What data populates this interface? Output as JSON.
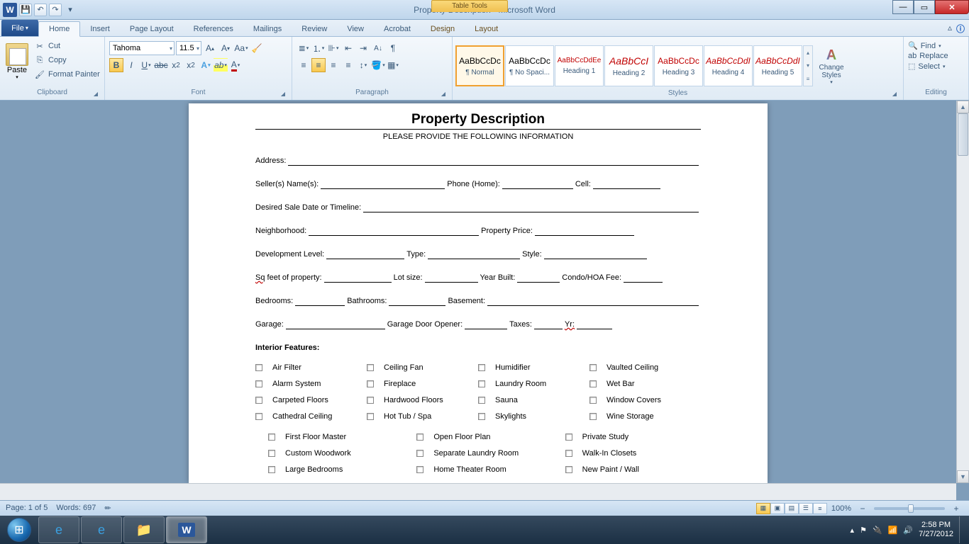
{
  "titlebar": {
    "title": "Property Description  -  Microsoft Word",
    "contextual": "Table Tools"
  },
  "tabs": {
    "file": "File",
    "home": "Home",
    "insert": "Insert",
    "page_layout": "Page Layout",
    "references": "References",
    "mailings": "Mailings",
    "review": "Review",
    "view": "View",
    "acrobat": "Acrobat",
    "design": "Design",
    "layout": "Layout"
  },
  "ribbon": {
    "clipboard": {
      "paste": "Paste",
      "cut": "Cut",
      "copy": "Copy",
      "format_painter": "Format Painter",
      "label": "Clipboard"
    },
    "font": {
      "name": "Tahoma",
      "size": "11.5",
      "label": "Font"
    },
    "paragraph": {
      "label": "Paragraph"
    },
    "styles": {
      "label": "Styles",
      "tiles": [
        {
          "preview": "AaBbCcDc",
          "name": "¶ Normal",
          "color": "#000",
          "sel": true
        },
        {
          "preview": "AaBbCcDc",
          "name": "¶ No Spaci...",
          "color": "#000"
        },
        {
          "preview": "AaBbCcDdEe",
          "name": "Heading 1",
          "color": "#c00000",
          "size": "10px"
        },
        {
          "preview": "AaBbCcI",
          "name": "Heading 2",
          "color": "#c00000",
          "size": "14px",
          "italic": true
        },
        {
          "preview": "AaBbCcDc",
          "name": "Heading 3",
          "color": "#c00000"
        },
        {
          "preview": "AaBbCcDdI",
          "name": "Heading 4",
          "color": "#c00000",
          "italic": true
        },
        {
          "preview": "AaBbCcDdI",
          "name": "Heading 5",
          "color": "#c00000",
          "italic": true
        }
      ],
      "change": "Change Styles"
    },
    "editing": {
      "find": "Find",
      "replace": "Replace",
      "select": "Select",
      "label": "Editing"
    }
  },
  "document": {
    "title": "Property Description",
    "subtitle": "PLEASE PROVIDE THE FOLLOWING INFORMATION",
    "labels": {
      "address": "Address:",
      "sellers": "Seller(s) Name(s):",
      "phone_home": "Phone (Home):",
      "cell": "Cell:",
      "timeline": "Desired Sale Date or Timeline:",
      "neighborhood": "Neighborhood:",
      "price": "Property Price:",
      "dev": "Development Level:",
      "type": "Type:",
      "style": "Style:",
      "sqft": "Sq feet of property:",
      "lot": "Lot size:",
      "year": "Year Built:",
      "hoa": "Condo/HOA Fee:",
      "bed": "Bedrooms:",
      "bath": "Bathrooms:",
      "basement": "Basement:",
      "garage": "Garage:",
      "opener": "Garage Door Opener:",
      "taxes": "Taxes:",
      "yr": "Yr:",
      "interior": "Interior Features:"
    },
    "features": {
      "col1": [
        "Air Filter",
        "Alarm System",
        "Carpeted Floors",
        "Cathedral Ceiling"
      ],
      "col2": [
        "Ceiling Fan",
        "Fireplace",
        "Hardwood Floors",
        "Hot Tub / Spa"
      ],
      "col3": [
        "Humidifier",
        "Laundry Room",
        "Sauna",
        "Skylights"
      ],
      "col4": [
        "Vaulted Ceiling",
        "Wet Bar",
        "Window Covers",
        "Wine Storage"
      ],
      "row2a": [
        "First Floor Master",
        "Custom Woodwork",
        "Large Bedrooms"
      ],
      "row2b": [
        "Open Floor Plan",
        "Separate Laundry Room",
        "Home Theater Room"
      ],
      "row2c": [
        "Private Study",
        "Walk-In Closets",
        "New Paint / Wall"
      ]
    }
  },
  "statusbar": {
    "page": "Page: 1 of 5",
    "words": "Words: 697",
    "zoom": "100%"
  },
  "taskbar": {
    "time": "2:58 PM",
    "date": "7/27/2012"
  }
}
